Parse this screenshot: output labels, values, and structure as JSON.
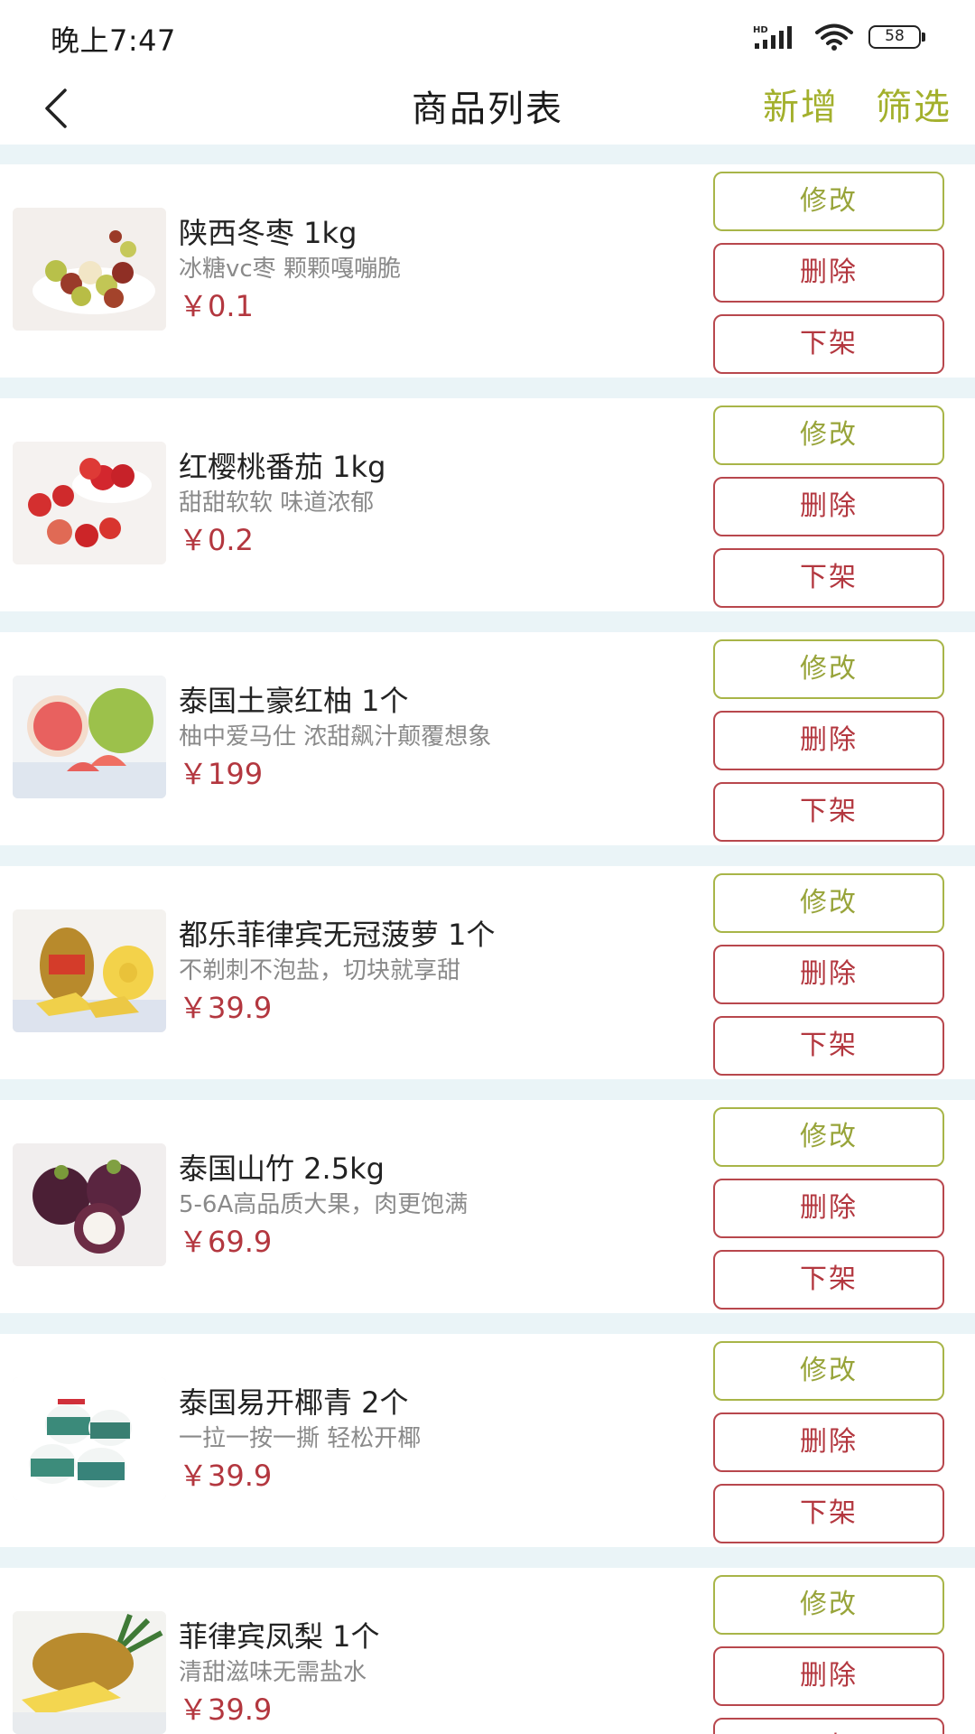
{
  "status_bar": {
    "time": "晚上7:47",
    "network": "HD",
    "battery": "58",
    "icons": [
      "signal-icon",
      "wifi-icon",
      "battery-icon"
    ]
  },
  "nav": {
    "back_icon": "chevron-left-icon",
    "title": "商品列表",
    "add_label": "新增",
    "filter_label": "筛选"
  },
  "colors": {
    "accent": "#a3b02c",
    "danger": "#b3373f",
    "background": "#eaf4f7"
  },
  "buttons": {
    "edit": "修改",
    "delete": "删除",
    "off_shelf": "下架"
  },
  "products": [
    {
      "name": "陕西冬枣 1kg",
      "desc": "冰糖vc枣 颗颗嘎嘣脆",
      "price": "￥0.1",
      "image": "jujube-image"
    },
    {
      "name": "红樱桃番茄 1kg",
      "desc": "甜甜软软 味道浓郁",
      "price": "￥0.2",
      "image": "cherry-tomato-image"
    },
    {
      "name": "泰国土豪红柚 1个",
      "desc": "柚中爱马仕 浓甜飙汁颠覆想象",
      "price": "￥199",
      "image": "pomelo-image"
    },
    {
      "name": "都乐菲律宾无冠菠萝 1个",
      "desc": "不剃刺不泡盐，切块就享甜",
      "price": "￥39.9",
      "image": "pineapple-image"
    },
    {
      "name": "泰国山竹 2.5kg",
      "desc": "5-6A高品质大果，肉更饱满",
      "price": "￥69.9",
      "image": "mangosteen-image"
    },
    {
      "name": "泰国易开椰青 2个",
      "desc": "一拉一按一撕 轻松开椰",
      "price": "￥39.9",
      "image": "coconut-image"
    },
    {
      "name": "菲律宾凤梨 1个",
      "desc": "清甜滋味无需盐水",
      "price": "￥39.9",
      "image": "pineapple-cut-image"
    }
  ]
}
